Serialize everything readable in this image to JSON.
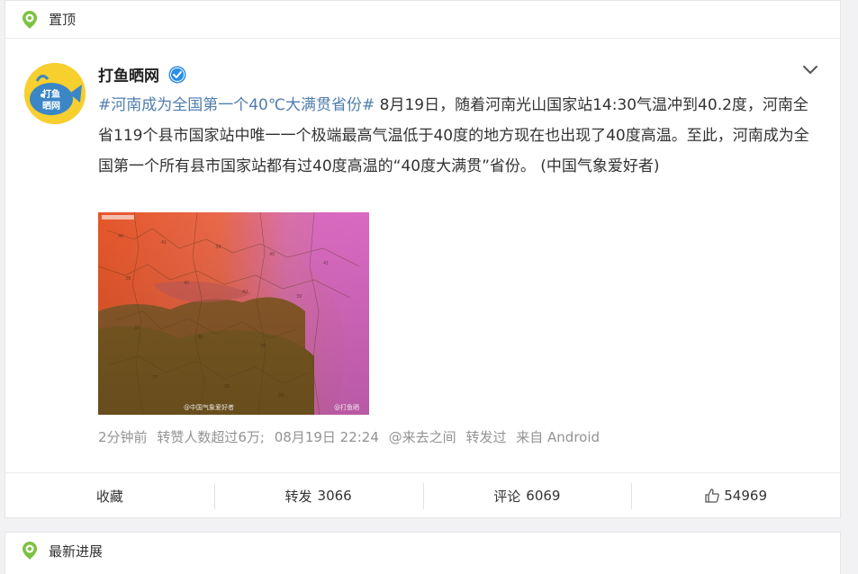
{
  "pinned_section": {
    "title": "置顶"
  },
  "post": {
    "author": "打鱼晒网",
    "avatar_text_line1": "打鱼",
    "avatar_text_line2": "晒网",
    "hashtag": "#河南成为全国第一个40℃大满贯省份#",
    "body": " 8月19日，随着河南光山国家站14:30气温冲到40.2度，河南全省119个县市国家站中唯一一个极端最高气温低于40度的地方现在也出现了40度高温。至此，河南成为全国第一个所有县市国家站都有过40度高温的“40度大满贯”省份。  (中国气象爱好者)",
    "photo_watermark_left": "@中国气象爱好者",
    "photo_watermark_right": "@打鱼晒",
    "meta": {
      "time": "2分钟前",
      "status": "转赞人数超过6万;",
      "datetime": "08月19日 22:24",
      "via_user": "@来去之间",
      "reposted": "转发过",
      "source": "来自 Android"
    },
    "actions": {
      "favorite": "收藏",
      "repost_label": "转发",
      "repost_count": "3066",
      "comment_label": "评论",
      "comment_count": "6069",
      "like_count": "54969"
    }
  },
  "latest_section": {
    "title": "最新进展"
  },
  "icons": {
    "pin": "location-pin-icon",
    "verified": "verified-badge-icon",
    "menu": "chevron-down-icon",
    "like": "thumbs-up-icon"
  },
  "colors": {
    "link": "#507daf",
    "pin_green": "#7cc242",
    "verified_blue": "#2a8ee6",
    "meta_gray": "#939393"
  }
}
